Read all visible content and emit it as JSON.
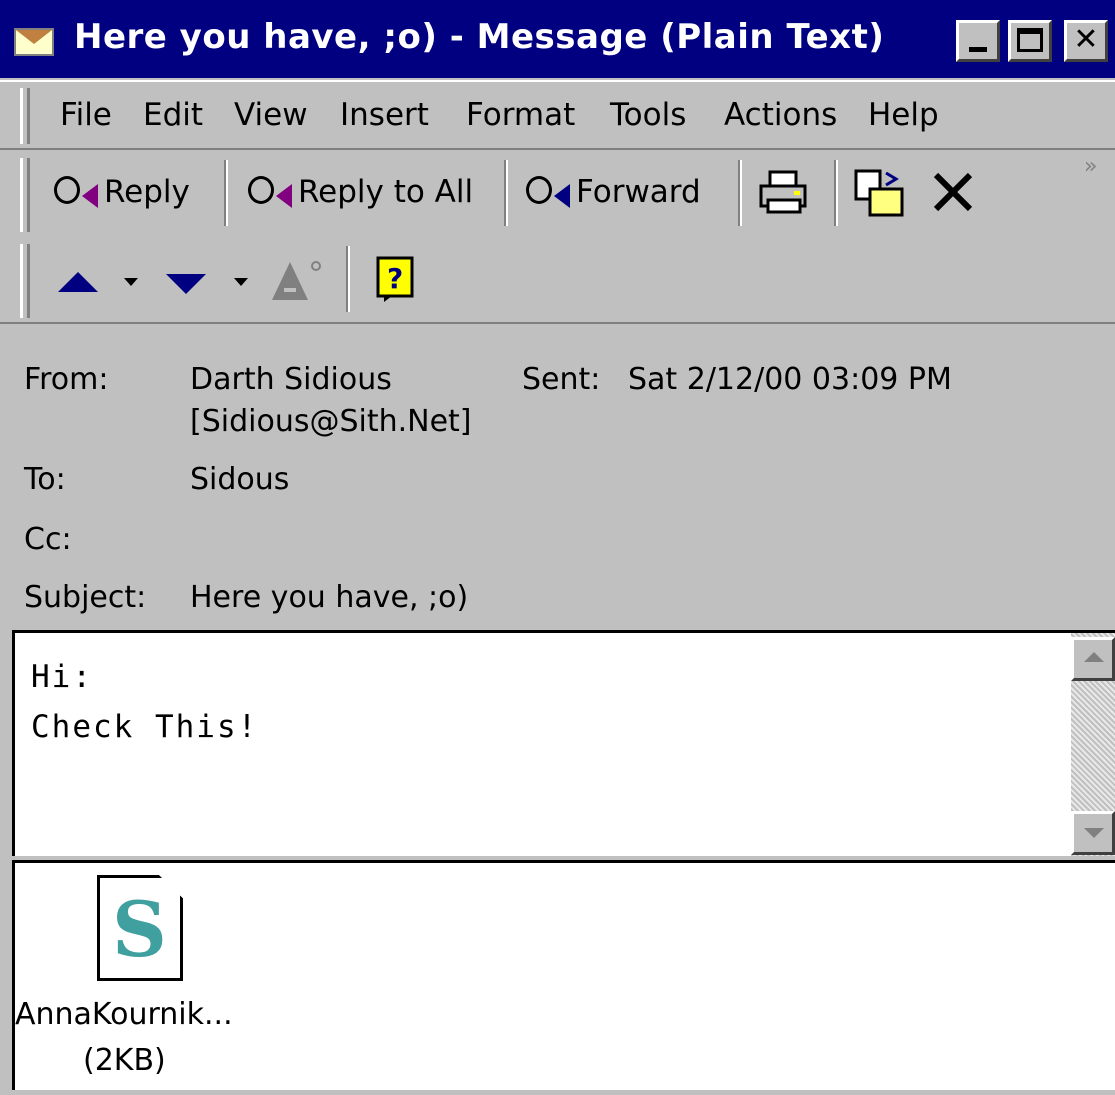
{
  "window": {
    "title": "Here you have, ;o) - Message (Plain Text)",
    "icon": "envelope-icon",
    "title_bar_color": "#000080"
  },
  "menu": {
    "items": [
      {
        "label": "File"
      },
      {
        "label": "Edit"
      },
      {
        "label": "View"
      },
      {
        "label": "Insert"
      },
      {
        "label": "Format"
      },
      {
        "label": "Tools"
      },
      {
        "label": "Actions"
      },
      {
        "label": "Help"
      }
    ]
  },
  "toolbar": {
    "reply_label": "Reply",
    "reply_all_label": "Reply to All",
    "forward_label": "Forward",
    "overflow": "»"
  },
  "header": {
    "from_label": "From:",
    "from_name": "Darth Sidious",
    "from_email": "[Sidious@Sith.Net]",
    "sent_label": "Sent:",
    "sent_value": "Sat 2/12/00 03:09 PM",
    "to_label": "To:",
    "to_value": "Sidous",
    "cc_label": "Cc:",
    "cc_value": "",
    "subject_label": "Subject:",
    "subject_value": "Here you have, ;o)"
  },
  "body": {
    "lines": [
      "Hi:",
      "Check This!"
    ]
  },
  "attachment": {
    "name": "AnnaKournik...",
    "size": "(2KB)",
    "icon": "script-file-icon"
  }
}
